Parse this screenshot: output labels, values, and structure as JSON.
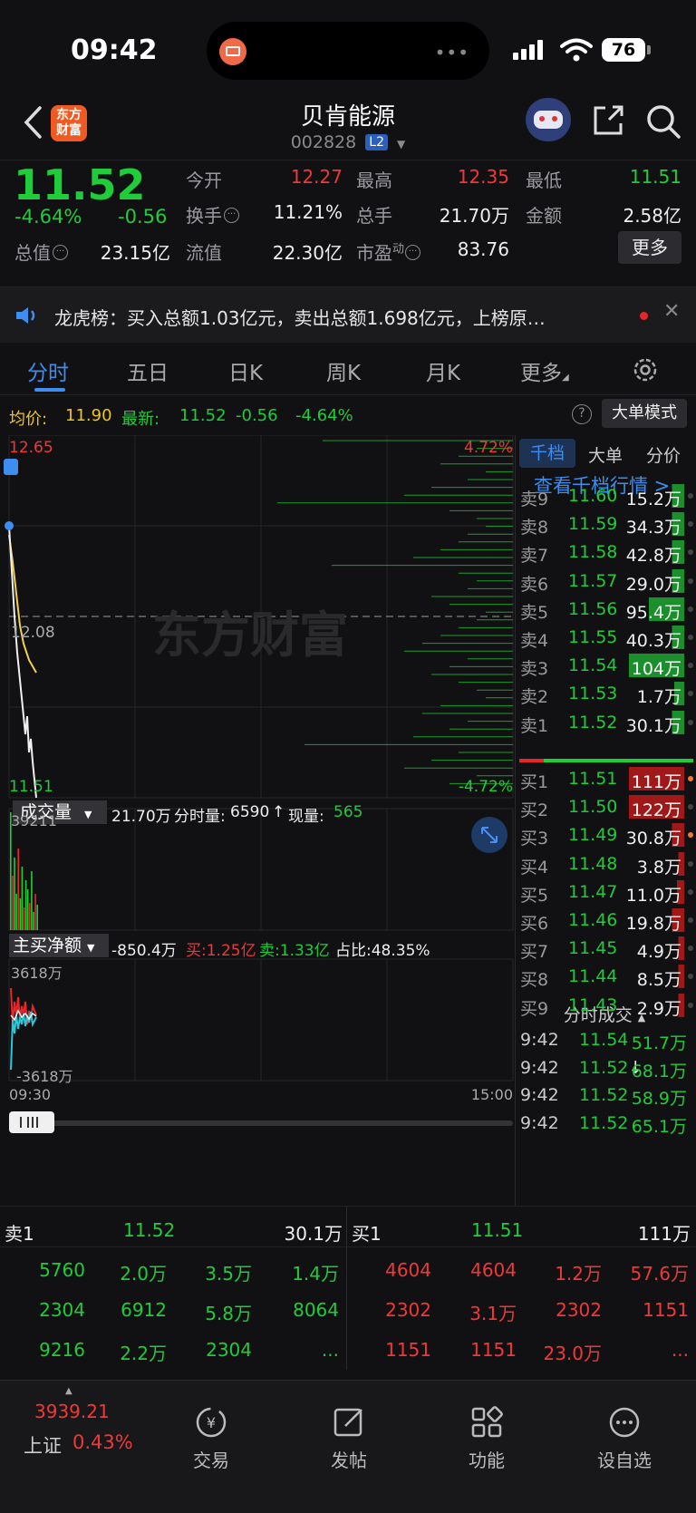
{
  "status_bar": {
    "time": "09:42",
    "battery": "76"
  },
  "header": {
    "title": "贝肯能源",
    "code": "002828",
    "level": "L2",
    "logo_text_1": "东方",
    "logo_text_2": "财富"
  },
  "quote": {
    "price": "11.52",
    "change_pct": "-4.64%",
    "change": "-0.56",
    "open_label": "今开",
    "open": "12.27",
    "high_label": "最高",
    "high": "12.35",
    "low_label": "最低",
    "low": "11.51",
    "turnover_label": "换手",
    "turnover": "11.21%",
    "volume_label": "总手",
    "volume": "21.70万",
    "amount_label": "金额",
    "amount": "2.58亿",
    "mktcap_label": "总值",
    "mktcap": "23.15亿",
    "float_label": "流值",
    "float": "22.30亿",
    "pe_label": "市盈",
    "pe_sup": "动",
    "pe": "83.76",
    "more_button": "更多"
  },
  "news": {
    "text": "龙虎榜：买入总额1.03亿元，卖出总额1.698亿元，上榜原…"
  },
  "tabs": [
    "分时",
    "五日",
    "日K",
    "周K",
    "月K",
    "更多"
  ],
  "avg_line": {
    "avg_label": "均价:",
    "avg": "11.90",
    "last_label": "最新:",
    "last": "11.52",
    "change": "-0.56",
    "pct": "-4.64%",
    "big_order_button": "大单模式"
  },
  "chart": {
    "y_top": "12.65",
    "y_mid": "12.08",
    "y_bottom": "11.51",
    "pct_top": "4.72%",
    "pct_bottom": "-4.72%",
    "watermark": "东方财富",
    "volume_dropdown": "成交量",
    "volume_total": "21.70万",
    "volume_minute_label": "分时量:",
    "volume_minute": "6590",
    "volume_arrow": "↑",
    "volume_now_label": "现量:",
    "volume_now": "565",
    "volume_max": "39211",
    "flow_dropdown": "主买净额",
    "flow_net": "-850.4万",
    "flow_buy": "买:1.25亿",
    "flow_sell": "卖:1.33亿",
    "flow_ratio": "占比:48.35%",
    "flow_top": "3618万",
    "flow_bottom": "-3618万",
    "time_start": "09:30",
    "time_end": "15:00"
  },
  "book": {
    "tabs": [
      "千档",
      "大单",
      "分价"
    ],
    "link": "查看千档行情 >",
    "asks": [
      {
        "label": "卖9",
        "price": "11.60",
        "vol": "15.2万"
      },
      {
        "label": "卖8",
        "price": "11.59",
        "vol": "34.3万"
      },
      {
        "label": "卖7",
        "price": "11.58",
        "vol": "42.8万"
      },
      {
        "label": "卖6",
        "price": "11.57",
        "vol": "29.0万"
      },
      {
        "label": "卖5",
        "price": "11.56",
        "vol": "95.4万"
      },
      {
        "label": "卖4",
        "price": "11.55",
        "vol": "40.3万"
      },
      {
        "label": "卖3",
        "price": "11.54",
        "vol": "104万"
      },
      {
        "label": "卖2",
        "price": "11.53",
        "vol": "1.7万"
      },
      {
        "label": "卖1",
        "price": "11.52",
        "vol": "30.1万"
      }
    ],
    "bids": [
      {
        "label": "买1",
        "price": "11.51",
        "vol": "111万"
      },
      {
        "label": "买2",
        "price": "11.50",
        "vol": "122万"
      },
      {
        "label": "买3",
        "price": "11.49",
        "vol": "30.8万"
      },
      {
        "label": "买4",
        "price": "11.48",
        "vol": "3.8万"
      },
      {
        "label": "买5",
        "price": "11.47",
        "vol": "11.0万"
      },
      {
        "label": "买6",
        "price": "11.46",
        "vol": "19.8万"
      },
      {
        "label": "买7",
        "price": "11.45",
        "vol": "4.9万"
      },
      {
        "label": "买8",
        "price": "11.44",
        "vol": "8.5万"
      },
      {
        "label": "买9",
        "price": "11.43",
        "vol": "2.9万"
      }
    ],
    "trades_title": "分时成交",
    "trades": [
      {
        "time": "9:42",
        "price": "11.54",
        "vol": "51.7万"
      },
      {
        "time": "9:42",
        "price": "11.52",
        "arrow": "↓",
        "vol": "68.1万"
      },
      {
        "time": "9:42",
        "price": "11.52",
        "vol": "58.9万"
      },
      {
        "time": "9:42",
        "price": "11.52",
        "vol": "65.1万"
      }
    ]
  },
  "queue": {
    "sell_label": "卖1",
    "sell_price": "11.52",
    "sell_total": "30.1万",
    "buy_label": "买1",
    "buy_price": "11.51",
    "buy_total": "111万",
    "sell_rows": [
      [
        "5760",
        "2.0万",
        "3.5万",
        "1.4万"
      ],
      [
        "2304",
        "6912",
        "5.8万",
        "8064"
      ],
      [
        "9216",
        "2.2万",
        "2304",
        "..."
      ]
    ],
    "buy_rows": [
      [
        "4604",
        "4604",
        "1.2万",
        "57.6万"
      ],
      [
        "2302",
        "3.1万",
        "2302",
        "1151"
      ],
      [
        "1151",
        "1151",
        "23.0万",
        "..."
      ]
    ]
  },
  "index": {
    "value": "3939.21",
    "name": "上证",
    "pct": "0.43%"
  },
  "nav": [
    "交易",
    "发帖",
    "功能",
    "设自选"
  ]
}
